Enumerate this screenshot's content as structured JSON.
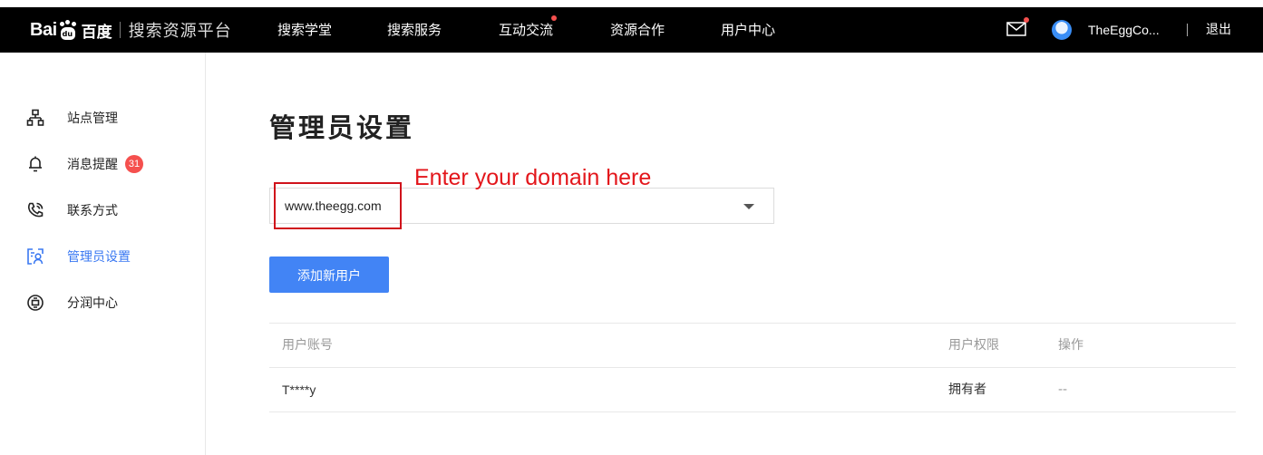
{
  "header": {
    "logo_text_latin": "Bai",
    "logo_paw_text": "du",
    "logo_text_cn": "百度",
    "platform_name": "搜索资源平台",
    "nav": [
      {
        "label": "搜索学堂",
        "has_dot": false
      },
      {
        "label": "搜索服务",
        "has_dot": false
      },
      {
        "label": "互动交流",
        "has_dot": true
      },
      {
        "label": "资源合作",
        "has_dot": false
      },
      {
        "label": "用户中心",
        "has_dot": false
      }
    ],
    "username": "TheEggCo...",
    "logout_label": "退出"
  },
  "sidebar": {
    "items": [
      {
        "label": "站点管理",
        "icon": "sitemap-icon",
        "active": false
      },
      {
        "label": "消息提醒",
        "icon": "bell-icon",
        "active": false,
        "badge": "31"
      },
      {
        "label": "联系方式",
        "icon": "phone-icon",
        "active": false
      },
      {
        "label": "管理员设置",
        "icon": "admin-settings-icon",
        "active": true
      },
      {
        "label": "分润中心",
        "icon": "revenue-share-icon",
        "active": false
      }
    ]
  },
  "main": {
    "title": "管理员设置",
    "annotation": "Enter your domain here",
    "site_select": {
      "value": "www.theegg.com"
    },
    "add_user_button": "添加新用户",
    "table": {
      "headers": [
        "用户账号",
        "用户权限",
        "操作"
      ],
      "rows": [
        [
          "T****y",
          "拥有者",
          "--"
        ]
      ]
    }
  },
  "colors": {
    "accent": "#4284f5",
    "active_text": "#3a78f2",
    "badge": "#f5504e",
    "annotation": "#e3161b",
    "topbar": "#000000"
  }
}
